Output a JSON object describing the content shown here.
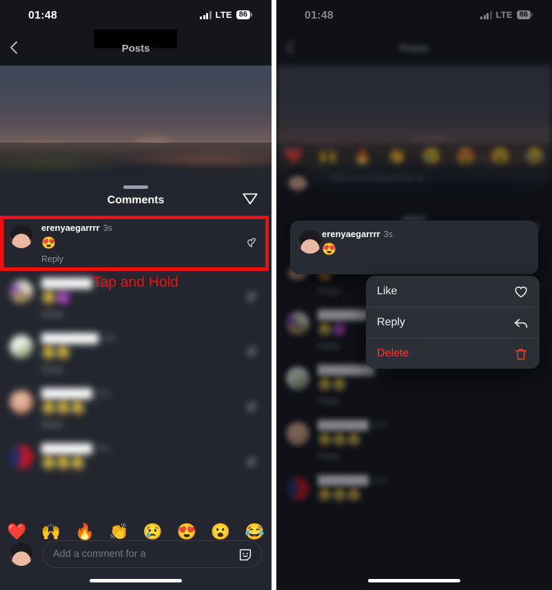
{
  "status_bar": {
    "time": "01:48",
    "network": "LTE",
    "battery": "86"
  },
  "nav": {
    "title": "Posts",
    "back_icon": "chevron-left-icon",
    "redacted_username": ""
  },
  "sheet": {
    "title": "Comments",
    "share_icon": "paper-plane-icon",
    "drag_handle": "sheet-drag-handle"
  },
  "highlighted_comment": {
    "username": "erenyaegarrrr",
    "time": "3s",
    "text": "😍",
    "reply_label": "Reply",
    "like_icon": "heart-outline-icon"
  },
  "other_comments": [
    {
      "username": "████████",
      "time": "17s",
      "text": "😂🟣",
      "reply_label": "Reply"
    },
    {
      "username": "█████████",
      "time": "17s",
      "text": "😂😂",
      "reply_label": "Reply"
    },
    {
      "username": "████████",
      "time": "17s",
      "text": "😂😂😂",
      "reply_label": "Reply"
    },
    {
      "username": "████████",
      "time": "17s",
      "text": "😂😂😂",
      "reply_label": "Reply"
    }
  ],
  "emoji_bar": [
    "❤️",
    "🙌",
    "🔥",
    "👏",
    "😢",
    "😍",
    "😮",
    "😂"
  ],
  "composer": {
    "placeholder": "Add a comment for a",
    "sticker_icon": "sticker-smiley-icon",
    "avatar": "user-avatar"
  },
  "annotation": {
    "label": "Tap and Hold",
    "color": "#ee1111"
  },
  "context_menu": {
    "items": [
      {
        "label": "Like",
        "icon": "heart-outline-icon",
        "danger": false
      },
      {
        "label": "Reply",
        "icon": "reply-arrow-icon",
        "danger": false
      },
      {
        "label": "Delete",
        "icon": "trash-icon",
        "danger": true
      }
    ]
  },
  "colors": {
    "accent_red": "#ee1111",
    "danger": "#ff3b30",
    "sheet_bg": "#23262e",
    "menu_bg": "#2c2f36"
  }
}
